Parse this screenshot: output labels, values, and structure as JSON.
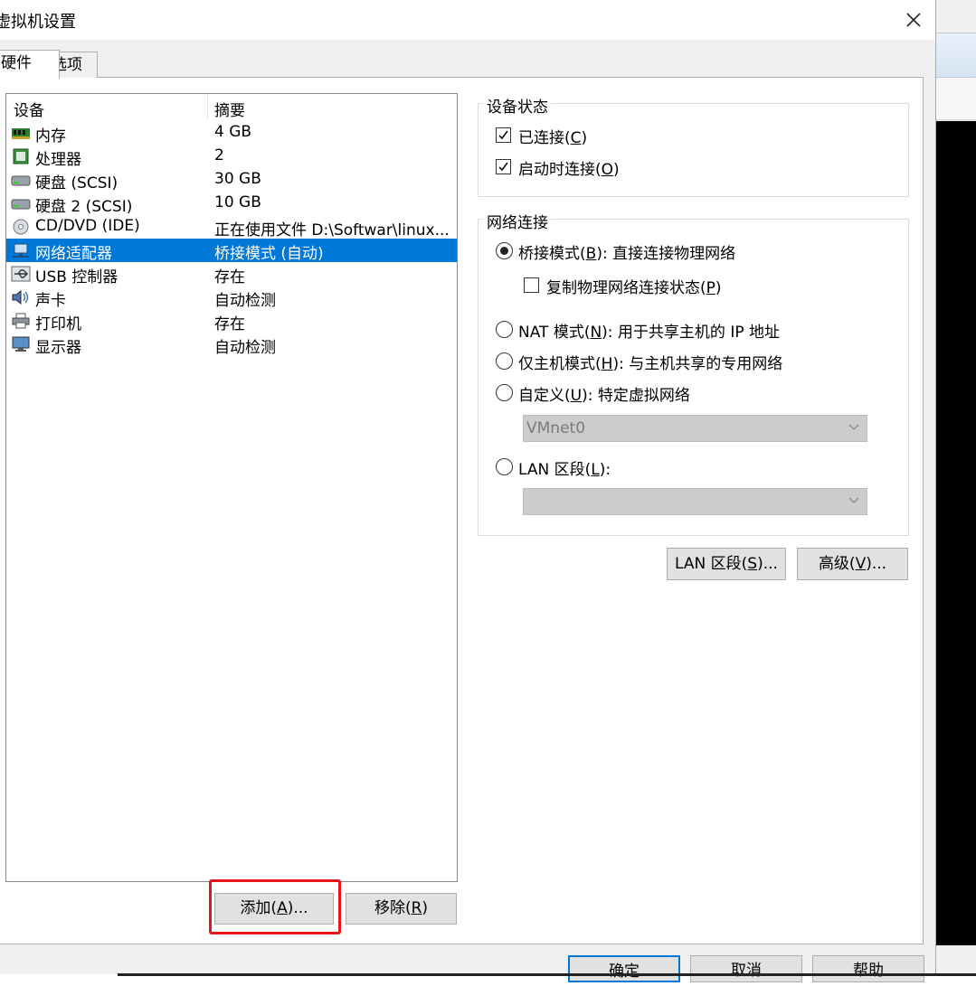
{
  "window": {
    "title": "虚拟机设置",
    "close_glyph": "✕"
  },
  "tabs": [
    {
      "label": "硬件"
    },
    {
      "label": "选项"
    }
  ],
  "device_list": {
    "headers": {
      "device": "设备",
      "summary": "摘要"
    },
    "rows": [
      {
        "name": "内存",
        "summary": "4 GB",
        "icon": "memory-icon"
      },
      {
        "name": "处理器",
        "summary": "2",
        "icon": "processor-icon"
      },
      {
        "name": "硬盘 (SCSI)",
        "summary": "30 GB",
        "icon": "hard-disk-icon"
      },
      {
        "name": "硬盘 2 (SCSI)",
        "summary": "10 GB",
        "icon": "hard-disk-icon"
      },
      {
        "name": "CD/DVD (IDE)",
        "summary": "正在使用文件 D:\\Softwar\\linux...",
        "icon": "cd-dvd-icon"
      },
      {
        "name": "网络适配器",
        "summary": "桥接模式 (自动)",
        "icon": "network-adapter-icon",
        "selected": true
      },
      {
        "name": "USB 控制器",
        "summary": "存在",
        "icon": "usb-icon"
      },
      {
        "name": "声卡",
        "summary": "自动检测",
        "icon": "sound-card-icon"
      },
      {
        "name": "打印机",
        "summary": "存在",
        "icon": "printer-icon"
      },
      {
        "name": "显示器",
        "summary": "自动检测",
        "icon": "display-icon"
      }
    ]
  },
  "buttons": {
    "add": {
      "pre": "添加(",
      "key": "A",
      "post": ")..."
    },
    "remove": {
      "pre": "移除(",
      "key": "R",
      "post": ")"
    },
    "lan_segments": {
      "pre": "LAN 区段(",
      "key": "S",
      "post": ")..."
    },
    "advanced": {
      "pre": "高级(",
      "key": "V",
      "post": ")..."
    },
    "ok": "确定",
    "cancel": "取消",
    "help": "帮助"
  },
  "device_status": {
    "title": "设备状态",
    "connected": {
      "pre": "已连接(",
      "key": "C",
      "post": ")",
      "checked": true
    },
    "connect_on_power_on": {
      "pre": "启动时连接(",
      "key": "O",
      "post": ")",
      "checked": true
    }
  },
  "network_connection": {
    "title": "网络连接",
    "bridged": {
      "pre": "桥接模式(",
      "key": "B",
      "post": "): 直接连接物理网络",
      "selected": true
    },
    "replicate": {
      "pre": "复制物理网络连接状态(",
      "key": "P",
      "post": ")",
      "checked": false
    },
    "nat": {
      "pre": "NAT 模式(",
      "key": "N",
      "post": "): 用于共享主机的 IP 地址",
      "selected": false
    },
    "host_only": {
      "pre": "仅主机模式(",
      "key": "H",
      "post": "): 与主机共享的专用网络",
      "selected": false
    },
    "custom": {
      "pre": "自定义(",
      "key": "U",
      "post": "): 特定虚拟网络",
      "selected": false
    },
    "custom_value": "VMnet0",
    "lan_segment": {
      "pre": "LAN 区段(",
      "key": "L",
      "post": "):",
      "selected": false
    },
    "lan_segment_value": ""
  },
  "colors": {
    "selection": "#0078d7",
    "highlight_box": "#e8141c",
    "dialog_bg": "#f0f0f0"
  }
}
